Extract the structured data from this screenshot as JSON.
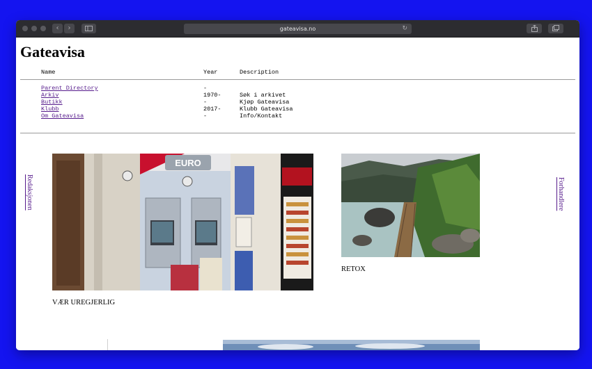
{
  "browser": {
    "url": "gateavisa.no",
    "back_icon": "chevron-left-icon",
    "forward_icon": "chevron-right-icon",
    "sidebar_icon": "sidebar-icon",
    "reload_icon": "reload-icon",
    "share_icon": "share-icon",
    "tabs_icon": "tabs-icon"
  },
  "site": {
    "title": "Gateavisa"
  },
  "listing": {
    "headers": {
      "name": "Name",
      "year": "Year",
      "description": "Description"
    },
    "rows": [
      {
        "name": "Parent Directory",
        "year": "-",
        "description": ""
      },
      {
        "name": "Arkiv",
        "year": "1970-",
        "description": "Søk i arkivet"
      },
      {
        "name": "Butikk",
        "year": "-",
        "description": "Kjøp Gateavisa"
      },
      {
        "name": "Klubb",
        "year": "2017-",
        "description": "Klubb Gateavisa"
      },
      {
        "name": "Om Gateavisa",
        "year": "-",
        "description": "Info/Kontakt"
      }
    ]
  },
  "side_links": {
    "left": "Redaksjonen",
    "right": "Forhandlere"
  },
  "articles": [
    {
      "caption": "VÆR UREGJERLIG",
      "photo_text": "EURO"
    },
    {
      "caption": "RETOX"
    }
  ],
  "colors": {
    "desktop": "#1414f0",
    "link": "#551a8b",
    "toolbar": "#2c2c30"
  }
}
